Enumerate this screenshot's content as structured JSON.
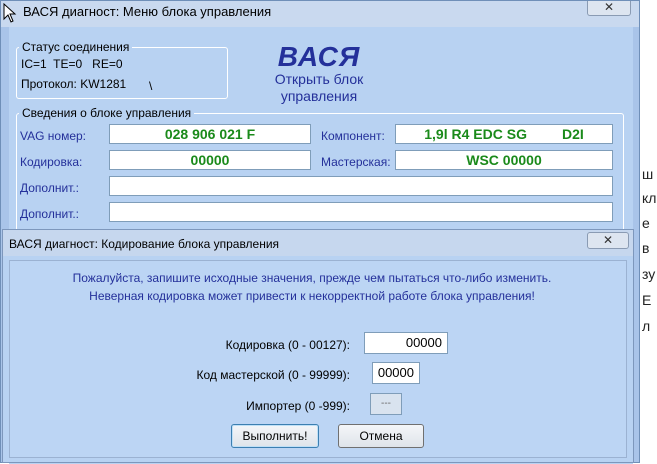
{
  "main_window": {
    "title": "ВАСЯ диагност: Меню блока управления",
    "close_glyph": "✕"
  },
  "status": {
    "legend": "Статус соединения",
    "line1": "IC=1  TE=0   RE=0",
    "protocol": "Протокол: KW1281",
    "spinner": "\\"
  },
  "brand": {
    "name": "ВАСЯ",
    "subtitle": "Открыть блок управления"
  },
  "unit_info": {
    "legend": "Сведения о блоке управления",
    "vag_label": "VAG номер:",
    "vag_value": "028 906 021 F",
    "component_label": "Компонент:",
    "component_value": "1,9l R4 EDC SG         D2I",
    "coding_label": "Кодировка:",
    "coding_value": "00000",
    "workshop_label": "Мастерская:",
    "workshop_value": "WSC 00000",
    "extra1_label": "Дополнит.:",
    "extra1_value": "",
    "extra2_label": "Дополнит.:",
    "extra2_value": ""
  },
  "dialog": {
    "title": "ВАСЯ диагност: Кодирование блока управления",
    "close_glyph": "✕",
    "message1": "Пожалуйста, запишите исходные значения, прежде чем пытаться что-либо изменить.",
    "message2": "Неверная кодировка может привести к некорректной работе блока управления!",
    "coding_label": "Кодировка (0 - 00127):",
    "coding_value": "00000",
    "workshop_label": "Код мастерской (0 - 99999):",
    "workshop_value": "00000",
    "importer_label": "Импортер (0 -999):",
    "importer_value": "---",
    "execute_button": "Выполнить!",
    "cancel_button": "Отмена"
  },
  "background": {
    "fragments": [
      "ш",
      "кл",
      "е",
      "в",
      "зу",
      "Е",
      "л"
    ]
  }
}
